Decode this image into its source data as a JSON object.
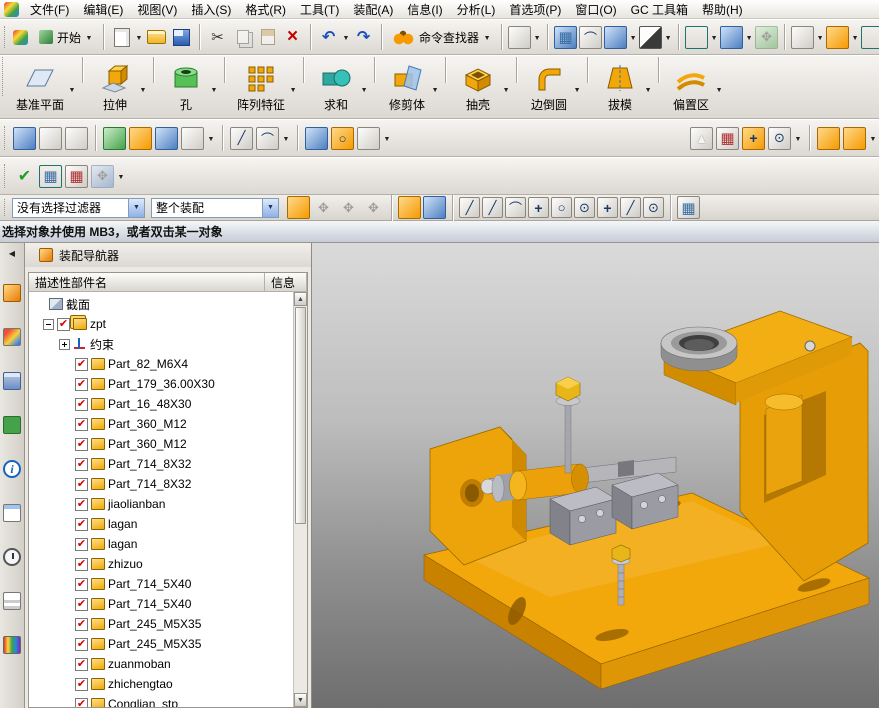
{
  "colors": {
    "model_orange": "#f2a70a",
    "model_orange_dark": "#cf8a00",
    "steel_gray": "#b6b6ba",
    "check_red": "#d40000",
    "viewport_top": "#dadada",
    "viewport_bottom": "#6e6e6e"
  },
  "menu": {
    "items": [
      "文件(F)",
      "编辑(E)",
      "视图(V)",
      "插入(S)",
      "格式(R)",
      "工具(T)",
      "装配(A)",
      "信息(I)",
      "分析(L)",
      "首选项(P)",
      "窗口(O)",
      "GC 工具箱",
      "帮助(H)"
    ]
  },
  "toolbar": {
    "start_label": "开始",
    "command_finder_label": "命令查找器"
  },
  "ribbon": {
    "items": [
      "基准平面",
      "拉伸",
      "孔",
      "阵列特征",
      "求和",
      "修剪体",
      "抽壳",
      "边倒圆",
      "拔模",
      "偏置区"
    ]
  },
  "selection_bar": {
    "filter_value": "没有选择过滤器",
    "scope_value": "整个装配"
  },
  "prompt": {
    "text": "选择对象并使用 MB3，或者双击某一对象"
  },
  "navigator": {
    "title": "装配导航器",
    "columns": {
      "name": "描述性部件名",
      "info": "信息"
    },
    "items": [
      {
        "label": "截面",
        "icon": "section",
        "checked": null,
        "expander": null,
        "level": 1
      },
      {
        "label": "zpt",
        "icon": "assembly",
        "checked": true,
        "expander": "minus",
        "level": 0
      },
      {
        "label": "约束",
        "icon": "constraints",
        "checked": null,
        "expander": "plus",
        "level": 2
      },
      {
        "label": "Part_82_M6X4",
        "icon": "part",
        "checked": true,
        "expander": null,
        "level": 2
      },
      {
        "label": "Part_179_36.00X30",
        "icon": "part",
        "checked": true,
        "expander": null,
        "level": 2
      },
      {
        "label": "Part_16_48X30",
        "icon": "part",
        "checked": true,
        "expander": null,
        "level": 2
      },
      {
        "label": "Part_360_M12",
        "icon": "part",
        "checked": true,
        "expander": null,
        "level": 2
      },
      {
        "label": "Part_360_M12",
        "icon": "part",
        "checked": true,
        "expander": null,
        "level": 2
      },
      {
        "label": "Part_714_8X32",
        "icon": "part",
        "checked": true,
        "expander": null,
        "level": 2
      },
      {
        "label": "Part_714_8X32",
        "icon": "part",
        "checked": true,
        "expander": null,
        "level": 2
      },
      {
        "label": "jiaolianban",
        "icon": "part",
        "checked": true,
        "expander": null,
        "level": 2
      },
      {
        "label": "lagan",
        "icon": "part",
        "checked": true,
        "expander": null,
        "level": 2
      },
      {
        "label": "lagan",
        "icon": "part",
        "checked": true,
        "expander": null,
        "level": 2
      },
      {
        "label": "zhizuo",
        "icon": "part",
        "checked": true,
        "expander": null,
        "level": 2
      },
      {
        "label": "Part_714_5X40",
        "icon": "part",
        "checked": true,
        "expander": null,
        "level": 2
      },
      {
        "label": "Part_714_5X40",
        "icon": "part",
        "checked": true,
        "expander": null,
        "level": 2
      },
      {
        "label": "Part_245_M5X35",
        "icon": "part",
        "checked": true,
        "expander": null,
        "level": 2
      },
      {
        "label": "Part_245_M5X35",
        "icon": "part",
        "checked": true,
        "expander": null,
        "level": 2
      },
      {
        "label": "zuanmoban",
        "icon": "part",
        "checked": true,
        "expander": null,
        "level": 2
      },
      {
        "label": "zhichengtao",
        "icon": "part",
        "checked": true,
        "expander": null,
        "level": 2
      },
      {
        "label": "Conglian_stp",
        "icon": "part",
        "checked": true,
        "expander": null,
        "level": 2
      }
    ]
  }
}
